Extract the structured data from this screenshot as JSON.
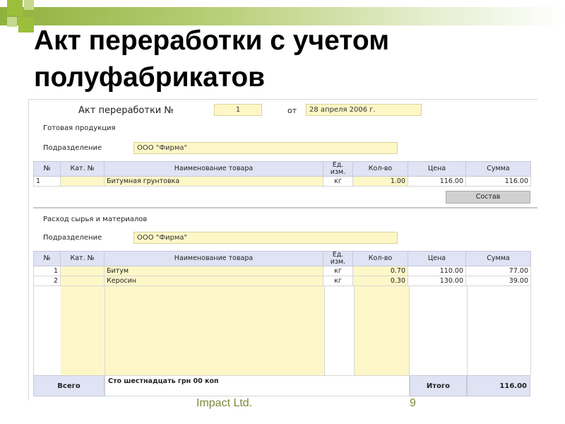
{
  "slide": {
    "title": "Акт переработки с учетом полуфабрикатов",
    "footer_company": "Impact Ltd.",
    "page_number": "9"
  },
  "document": {
    "title_label": "Акт переработки №",
    "number": "1",
    "date_label": "от",
    "date": "28 апреля 2006 г."
  },
  "finished": {
    "section_title": "Готовая продукция",
    "division_label": "Подразделение",
    "division_value": "ООО \"Фирма\"",
    "columns": [
      "№",
      "Кат. №",
      "Наименование товара",
      "Ед. изм.",
      "Кол-во",
      "Цена",
      "Сумма"
    ],
    "rows": [
      {
        "n": "1",
        "cat": "",
        "name": "Битумная грунтовка",
        "unit": "кг",
        "qty": "1.00",
        "price": "116.00",
        "sum": "116.00"
      }
    ],
    "compose_button": "Состав"
  },
  "materials": {
    "section_title": "Расход сырья и материалов",
    "division_label": "Подразделение",
    "division_value": "ООО \"Фирма\"",
    "columns": [
      "№",
      "Кат. №",
      "Наименование товара",
      "Ед. изм.",
      "Кол-во",
      "Цена",
      "Сумма"
    ],
    "rows": [
      {
        "n": "1",
        "cat": "",
        "name": "Битум",
        "unit": "кг",
        "qty": "0.70",
        "price": "110.00",
        "sum": "77.00"
      },
      {
        "n": "2",
        "cat": "",
        "name": "Керосин",
        "unit": "кг",
        "qty": "0.30",
        "price": "130.00",
        "sum": "39.00"
      }
    ],
    "total_label": "Всего",
    "total_words": "Сто шестнадцать грн 00 коп",
    "grand_label": "Итого",
    "grand_value": "116.00"
  }
}
